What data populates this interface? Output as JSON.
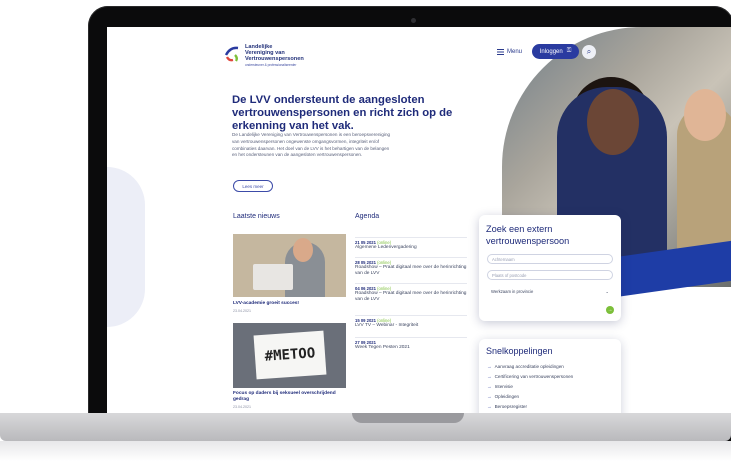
{
  "brand": {
    "line1": "Landelijke",
    "line2": "Vereniging van",
    "line3": "Vertrouwenspersonen",
    "tagline": "ondersteuner & professionaliseerder",
    "colors": {
      "navy": "#1f2b7a",
      "green": "#7cbf3a",
      "blue": "#2a3ba0"
    }
  },
  "header": {
    "menu_label": "Menu",
    "login_label": "Inloggen",
    "menu_icon": "hamburger-icon",
    "search_icon": "search-icon"
  },
  "hero": {
    "title": "De LVV ondersteunt de aangesloten vertrouwenspersonen en richt zich op de erkenning van het vak.",
    "text": "De Landelijke Vereniging van Vertrouwenspersonen is een beroepsvereniging van vertrouwenspersonen ongewenste omgangsvormen, integriteit en/of combinaties daarvan. Het doel van de LVV is het behartigen van de belangen en het ondersteunen van de aangesloten vertrouwenspersonen.",
    "more_label": "Lees meer"
  },
  "news": {
    "heading": "Laatste nieuws",
    "items": [
      {
        "title": "LVV-academie groeit succes!",
        "date": "23.04.2021"
      },
      {
        "title": "Focus op daders bij seksueel overschrijdend gedrag",
        "date": "23.04.2021",
        "image_text": "#METOO"
      }
    ]
  },
  "agenda": {
    "heading": "Agenda",
    "items": [
      {
        "date": "21 05 2021",
        "tag": "(online)",
        "text": "Algemene Ledenvergadering"
      },
      {
        "date": "28 05 2021",
        "tag": "(online)",
        "text": "Roadshow – Praat digitaal mee over de herinrichting van de LVV"
      },
      {
        "date": "04 06 2021",
        "tag": "(online)",
        "text": "Roadshow – Praat digitaal mee over de herinrichting van de LVV"
      },
      {
        "date": "15 09 2021",
        "tag": "(online)",
        "text": "LVV TV – Webinar - Integriteit"
      },
      {
        "date": "27 09 2021",
        "tag": "",
        "text": "Week Tegen Pesten 2021"
      }
    ]
  },
  "search": {
    "title": "Zoek een extern vertrouwenspersoon",
    "name_placeholder": "Achternaam",
    "place_placeholder": "Plaats of postcode",
    "province_label": "Werkzaam in provincie"
  },
  "quick": {
    "title": "Snelkoppelingen",
    "items": [
      "Aanvraag accreditatie opleidingen",
      "Certificering van vertrouwenspersonen",
      "Intervisie",
      "Opleidingen",
      "Beroepsregister"
    ]
  }
}
